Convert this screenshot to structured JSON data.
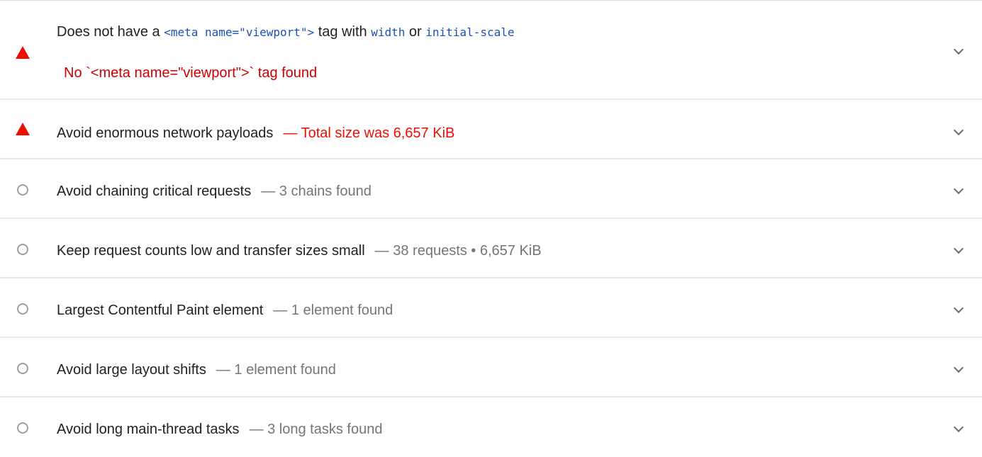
{
  "audits": [
    {
      "status": "fail",
      "icon": "warning-triangle-icon",
      "title_parts": [
        "Does not have a ",
        "<meta name=\"viewport\">",
        " tag with ",
        "width",
        " or ",
        "initial-scale"
      ],
      "error": "No `<meta name=\"viewport\">` tag found"
    },
    {
      "status": "fail",
      "icon": "warning-triangle-icon",
      "title": "Avoid enormous network payloads",
      "display_value": "Total size was 6,657 KiB"
    },
    {
      "status": "informative",
      "icon": "info-circle-icon",
      "title": "Avoid chaining critical requests",
      "display_value": "3 chains found"
    },
    {
      "status": "informative",
      "icon": "info-circle-icon",
      "title": "Keep request counts low and transfer sizes small",
      "display_value": "38 requests • 6,657 KiB"
    },
    {
      "status": "informative",
      "icon": "info-circle-icon",
      "title": "Largest Contentful Paint element",
      "display_value": "1 element found"
    },
    {
      "status": "informative",
      "icon": "info-circle-icon",
      "title": "Avoid large layout shifts",
      "display_value": "1 element found"
    },
    {
      "status": "informative",
      "icon": "info-circle-icon",
      "title": "Avoid long main-thread tasks",
      "display_value": "3 long tasks found"
    }
  ],
  "separator": "—",
  "colors": {
    "fail": "#eb0f00",
    "informative": "#9e9e9e",
    "code": "#1a50b6",
    "muted": "#757575"
  }
}
